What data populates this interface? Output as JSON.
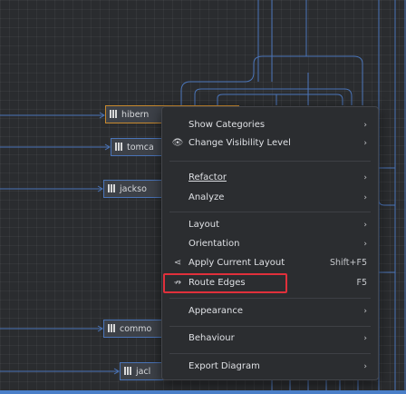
{
  "nodes": [
    {
      "id": "hibernate",
      "label": "hibern"
    },
    {
      "id": "tomcat",
      "label": "tomca"
    },
    {
      "id": "jackson",
      "label": "jackso"
    },
    {
      "id": "commons",
      "label": "commo"
    },
    {
      "id": "jackson2",
      "label": "jacl"
    }
  ],
  "menu": {
    "items": [
      {
        "label": "Show Categories",
        "arrow": "›"
      },
      {
        "label": "Change Visibility Level",
        "icon": "👁",
        "arrow": "›"
      },
      {
        "label": "Refactor",
        "arrow": "›"
      },
      {
        "label": "Analyze",
        "arrow": "›"
      },
      {
        "label": "Layout",
        "arrow": "›"
      },
      {
        "label": "Orientation",
        "arrow": "›"
      },
      {
        "label": "Apply Current Layout",
        "icon": "⋖",
        "shortcut": "Shift+F5"
      },
      {
        "label": "Route Edges",
        "icon": "↛",
        "shortcut": "F5"
      },
      {
        "label": "Appearance",
        "arrow": "›"
      },
      {
        "label": "Behaviour",
        "arrow": "›"
      },
      {
        "label": "Export Diagram",
        "arrow": "›"
      }
    ]
  },
  "colors": {
    "edge": "#4a74b8",
    "selected_node_border": "#c98a2e",
    "highlight": "#e0303b",
    "menu_bg": "#2b2d30"
  }
}
